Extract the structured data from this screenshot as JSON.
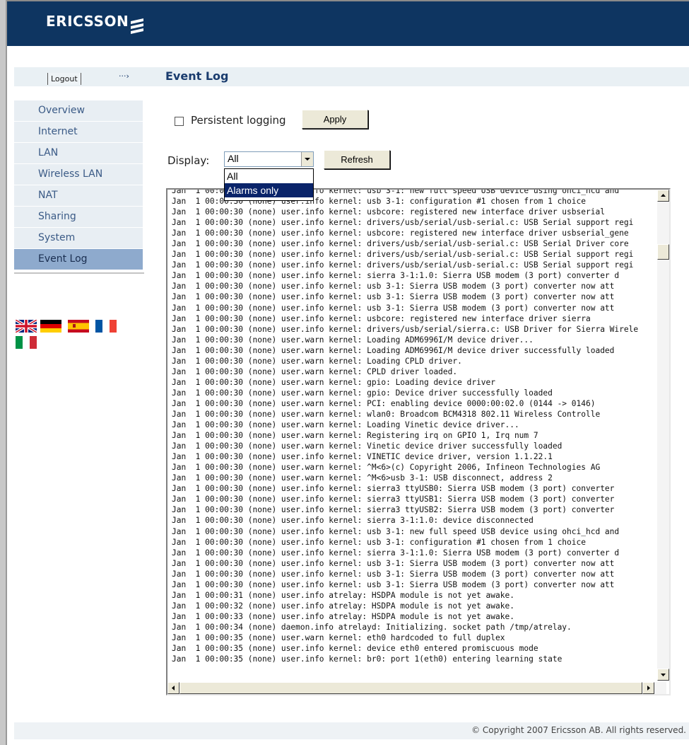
{
  "brand": {
    "name": "ERICSSON"
  },
  "header": {
    "logout_label": "Logout",
    "page_title": "Event Log"
  },
  "nav": {
    "items": [
      "Overview",
      "Internet",
      "LAN",
      "Wireless LAN",
      "NAT",
      "Sharing",
      "System",
      "Event Log"
    ],
    "active": "Event Log"
  },
  "languages": [
    "English",
    "German",
    "Spanish",
    "French",
    "Italian"
  ],
  "form": {
    "persistent_logging_label": "Persistent logging",
    "persistent_logging_checked": false,
    "apply_label": "Apply",
    "display_label": "Display:",
    "display_value": "All",
    "display_options": [
      "All",
      "Alarms only"
    ],
    "display_highlighted": "Alarms only",
    "refresh_label": "Refresh"
  },
  "log_lines": [
    "Jan  1 00:00:30 (none) user.info kernel: usb 3-1: new full speed USB device using ohci_hcd and",
    "Jan  1 00:00:30 (none) user.info kernel: usb 3-1: configuration #1 chosen from 1 choice",
    "Jan  1 00:00:30 (none) user.info kernel: usbcore: registered new interface driver usbserial",
    "Jan  1 00:00:30 (none) user.info kernel: drivers/usb/serial/usb-serial.c: USB Serial support regi",
    "Jan  1 00:00:30 (none) user.info kernel: usbcore: registered new interface driver usbserial_gene",
    "Jan  1 00:00:30 (none) user.info kernel: drivers/usb/serial/usb-serial.c: USB Serial Driver core",
    "Jan  1 00:00:30 (none) user.info kernel: drivers/usb/serial/usb-serial.c: USB Serial support regi",
    "Jan  1 00:00:30 (none) user.info kernel: drivers/usb/serial/usb-serial.c: USB Serial support regi",
    "Jan  1 00:00:30 (none) user.info kernel: sierra 3-1:1.0: Sierra USB modem (3 port) converter d",
    "Jan  1 00:00:30 (none) user.info kernel: usb 3-1: Sierra USB modem (3 port) converter now att",
    "Jan  1 00:00:30 (none) user.info kernel: usb 3-1: Sierra USB modem (3 port) converter now att",
    "Jan  1 00:00:30 (none) user.info kernel: usb 3-1: Sierra USB modem (3 port) converter now att",
    "Jan  1 00:00:30 (none) user.info kernel: usbcore: registered new interface driver sierra",
    "Jan  1 00:00:30 (none) user.info kernel: drivers/usb/serial/sierra.c: USB Driver for Sierra Wirele",
    "Jan  1 00:00:30 (none) user.warn kernel: Loading ADM6996I/M device driver...",
    "Jan  1 00:00:30 (none) user.warn kernel: Loading ADM6996I/M device driver successfully loaded",
    "Jan  1 00:00:30 (none) user.warn kernel: Loading CPLD driver.",
    "Jan  1 00:00:30 (none) user.warn kernel: CPLD driver loaded.",
    "Jan  1 00:00:30 (none) user.warn kernel: gpio: Loading device driver",
    "Jan  1 00:00:30 (none) user.warn kernel: gpio: Device driver successfully loaded",
    "Jan  1 00:00:30 (none) user.warn kernel: PCI: enabling device 0000:00:02.0 (0144 -> 0146)",
    "Jan  1 00:00:30 (none) user.warn kernel: wlan0: Broadcom BCM4318 802.11 Wireless Controlle",
    "Jan  1 00:00:30 (none) user.warn kernel: Loading Vinetic device driver...",
    "Jan  1 00:00:30 (none) user.warn kernel: Registering irq on GPIO 1, Irq num 7",
    "Jan  1 00:00:30 (none) user.warn kernel: Vinetic device driver successfully loaded",
    "Jan  1 00:00:30 (none) user.info kernel: VINETIC device driver, version 1.1.22.1",
    "Jan  1 00:00:30 (none) user.warn kernel: ^M<6>(c) Copyright 2006, Infineon Technologies AG",
    "Jan  1 00:00:30 (none) user.warn kernel: ^M<6>usb 3-1: USB disconnect, address 2",
    "Jan  1 00:00:30 (none) user.info kernel: sierra3 ttyUSB0: Sierra USB modem (3 port) converter",
    "Jan  1 00:00:30 (none) user.info kernel: sierra3 ttyUSB1: Sierra USB modem (3 port) converter",
    "Jan  1 00:00:30 (none) user.info kernel: sierra3 ttyUSB2: Sierra USB modem (3 port) converter",
    "Jan  1 00:00:30 (none) user.info kernel: sierra 3-1:1.0: device disconnected",
    "Jan  1 00:00:30 (none) user.info kernel: usb 3-1: new full speed USB device using ohci_hcd and",
    "Jan  1 00:00:30 (none) user.info kernel: usb 3-1: configuration #1 chosen from 1 choice",
    "Jan  1 00:00:30 (none) user.info kernel: sierra 3-1:1.0: Sierra USB modem (3 port) converter d",
    "Jan  1 00:00:30 (none) user.info kernel: usb 3-1: Sierra USB modem (3 port) converter now att",
    "Jan  1 00:00:30 (none) user.info kernel: usb 3-1: Sierra USB modem (3 port) converter now att",
    "Jan  1 00:00:30 (none) user.info kernel: usb 3-1: Sierra USB modem (3 port) converter now att",
    "Jan  1 00:00:31 (none) user.info atrelay: HSDPA module is not yet awake.",
    "Jan  1 00:00:32 (none) user.info atrelay: HSDPA module is not yet awake.",
    "Jan  1 00:00:33 (none) user.info atrelay: HSDPA module is not yet awake.",
    "Jan  1 00:00:34 (none) daemon.info atrelayd: Initializing. socket path /tmp/atrelay.",
    "Jan  1 00:00:35 (none) user.warn kernel: eth0 hardcoded to full duplex",
    "Jan  1 00:00:35 (none) user.info kernel: device eth0 entered promiscuous mode",
    "Jan  1 00:00:35 (none) user.info kernel: br0: port 1(eth0) entering learning state"
  ],
  "footer": {
    "copyright": "© Copyright 2007 Ericsson AB. All rights reserved."
  }
}
